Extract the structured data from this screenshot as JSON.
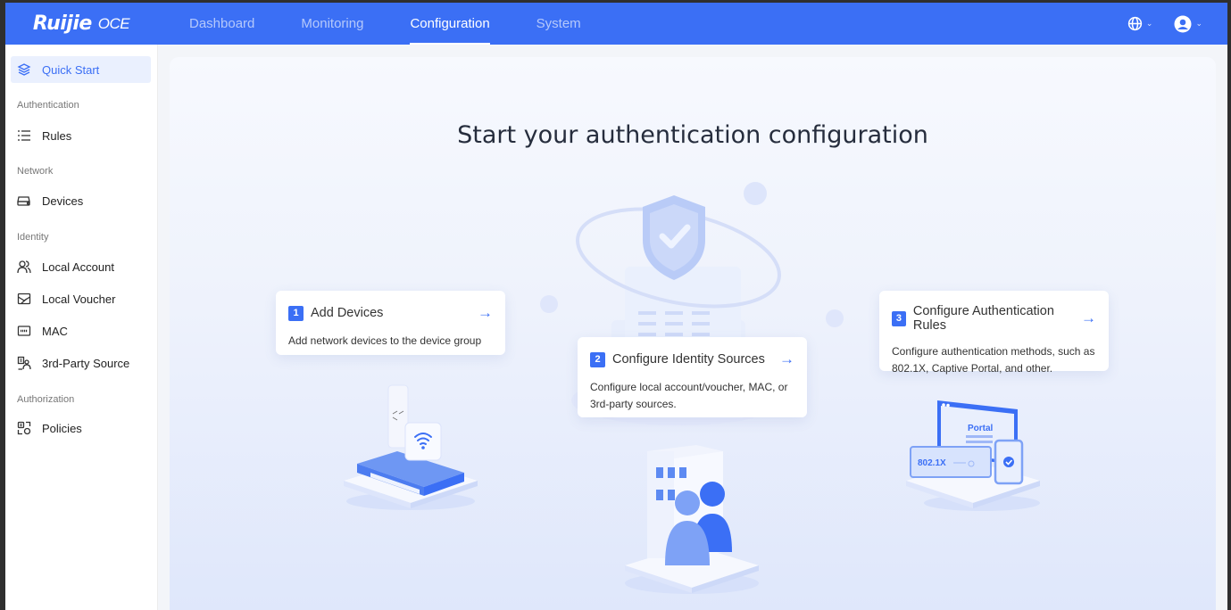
{
  "brand": {
    "logo": "Ruijie",
    "product": "OCE"
  },
  "nav": {
    "items": [
      {
        "label": "Dashboard",
        "active": false
      },
      {
        "label": "Monitoring",
        "active": false
      },
      {
        "label": "Configuration",
        "active": true
      },
      {
        "label": "System",
        "active": false
      }
    ]
  },
  "topbar": {
    "language_icon": "globe-icon",
    "user_icon": "user-avatar-icon"
  },
  "sidebar": {
    "quick_start": "Quick Start",
    "groups": {
      "authentication": "Authentication",
      "network": "Network",
      "identity": "Identity",
      "authorization": "Authorization"
    },
    "items": {
      "rules": "Rules",
      "devices": "Devices",
      "local_account": "Local Account",
      "local_voucher": "Local Voucher",
      "mac": "MAC",
      "third_party": "3rd-Party Source",
      "policies": "Policies"
    }
  },
  "main": {
    "title": "Start your authentication configuration",
    "steps": [
      {
        "number": "1",
        "title": "Add Devices",
        "desc": "Add network devices to the device group"
      },
      {
        "number": "2",
        "title": "Configure Identity Sources",
        "desc": "Configure local account/voucher, MAC, or 3rd-party sources."
      },
      {
        "number": "3",
        "title": "Configure Authentication Rules",
        "desc": "Configure authentication methods, such as 802.1X, Captive Portal, and other."
      }
    ],
    "illustration_labels": {
      "portal": "Portal",
      "dot1x": "802.1X"
    }
  },
  "colors": {
    "accent": "#3b6ff5",
    "active_bg": "#eaf0fe"
  }
}
